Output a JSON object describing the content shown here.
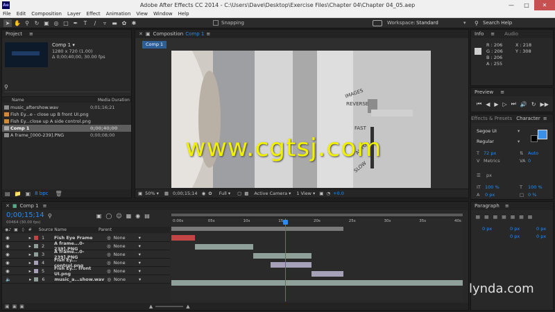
{
  "window": {
    "title": "Adobe After Effects CC 2014 - C:\\Users\\Dave\\Desktop\\Exercise Files\\Chapter 04\\Chapter 04_05.aep",
    "app_icon": "Ae"
  },
  "menu": [
    "File",
    "Edit",
    "Composition",
    "Layer",
    "Effect",
    "Animation",
    "View",
    "Window",
    "Help"
  ],
  "toolbar": {
    "snapping_label": "Snapping",
    "workspace_label": "Workspace:",
    "workspace_value": "Standard",
    "search_placeholder": "Search Help"
  },
  "project": {
    "tab": "Project",
    "comp_name": "Comp 1 ▾",
    "comp_size": "1280 x 720 (1.00)",
    "comp_duration": "Δ 0;00;40;00, 30.00 fps",
    "col_name": "Name",
    "col_duration": "Media Duration",
    "items": [
      {
        "name": "music_aftershow.wav",
        "dur": "0;01;16;21"
      },
      {
        "name": "Fish Ey...e - close up B front UI.png",
        "dur": ""
      },
      {
        "name": "Fish Ey...close up A side control.png",
        "dur": ""
      },
      {
        "name": "Comp 1",
        "dur": "0;00;40;00"
      },
      {
        "name": "A frame_[000-239].PNG",
        "dur": "0;00;08;00"
      }
    ],
    "bpc": "8 bpc"
  },
  "composition": {
    "tab": "Composition",
    "tab_comp": "Comp 1",
    "sub_tab": "Comp 1",
    "zoom": "50%",
    "timecode": "0;00;15;14",
    "resolution": "Full",
    "camera": "Active Camera",
    "view": "1 View",
    "exposure": "+0.0",
    "watermark": "www.cgtsj.com",
    "image_labels": [
      "IMAGES",
      "REVERSE",
      "FAST",
      "AUTO",
      "SLOW"
    ]
  },
  "info": {
    "tab": "Info",
    "tab2": "Audio",
    "r": "R : 206",
    "g": "G : 206",
    "b": "B : 206",
    "a": "A : 255",
    "x": "X : 218",
    "y": "Y : 308"
  },
  "preview": {
    "tab": "Preview"
  },
  "effects": {
    "tab": "Effects & Presets"
  },
  "character": {
    "tab": "Character",
    "font": "Segoe UI",
    "style": "Regular",
    "size": "72 px",
    "leading": "Auto",
    "kerning": "Metrics",
    "tracking": "0",
    "stroke": "px",
    "vscale": "100 %",
    "hscale": "100 %",
    "baseline": "0 px",
    "tsume": "0 %"
  },
  "paragraph": {
    "tab": "Paragraph",
    "indent1": "0 px",
    "indent2": "0 px",
    "indent3": "0 px",
    "space1": "0 px",
    "space2": "0 px"
  },
  "timeline": {
    "tab": "Comp 1",
    "timecode": "0;00;15;14",
    "frames": "00464 (30.00 fps)",
    "col_source": "Source Name",
    "col_parent": "Parent",
    "ticks": [
      "0:00s",
      "05s",
      "10s",
      "15s",
      "20s",
      "25s",
      "30s",
      "35s",
      "40s"
    ],
    "layers": [
      {
        "num": "1",
        "name": "Fish Eye Frame",
        "parent": "None",
        "color": "#c24545",
        "start": 0.0,
        "end": 0.08
      },
      {
        "num": "2",
        "name": "A frame...0-239].PNG",
        "parent": "None",
        "color": "#8fa09a",
        "start": 0.08,
        "end": 0.28
      },
      {
        "num": "3",
        "name": "A frame...0-239].PNG",
        "parent": "None",
        "color": "#8fa09a",
        "start": 0.28,
        "end": 0.48
      },
      {
        "num": "4",
        "name": "Fish Ey... control.png",
        "parent": "None",
        "color": "#a6a0b8",
        "start": 0.34,
        "end": 0.48
      },
      {
        "num": "5",
        "name": "Fish Ey... front UI.png",
        "parent": "None",
        "color": "#a6a0b8",
        "start": 0.48,
        "end": 0.59
      },
      {
        "num": "6",
        "name": "music_a...show.wav",
        "parent": "None",
        "color": "#8fa09a",
        "start": 0.0,
        "end": 1.0
      }
    ],
    "playhead": 0.39,
    "work_area_end": 0.59
  },
  "lynda": "lynda.com",
  "colors": {
    "accent": "#2d8ceb",
    "swatch": "#3a8fe8",
    "playhead": "#e03c3c"
  }
}
